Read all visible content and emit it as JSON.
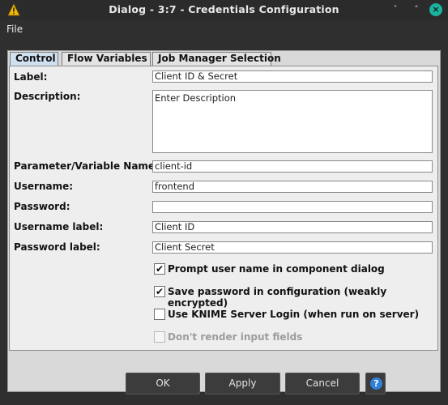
{
  "window": {
    "title": "Dialog - 3:7 - Credentials Configuration",
    "minimize_glyph": "ˇ",
    "maximize_glyph": "˄",
    "close_glyph": "×",
    "app_icon": "warning-triangle-icon"
  },
  "menu": {
    "file_label": "File"
  },
  "tabs": [
    {
      "label": "Control",
      "active": true
    },
    {
      "label": "Flow Variables",
      "active": false
    },
    {
      "label": "Job Manager Selection",
      "active": false
    }
  ],
  "form": {
    "label": {
      "label": "Label:",
      "value": "Client ID & Secret"
    },
    "description": {
      "label": "Description:",
      "value": "Enter Description"
    },
    "param_name": {
      "label": "Parameter/Variable Name:",
      "value": "client-id"
    },
    "username": {
      "label": "Username:",
      "value": "frontend"
    },
    "password": {
      "label": "Password:",
      "value": ""
    },
    "username_label": {
      "label": "Username label:",
      "value": "Client ID"
    },
    "password_label": {
      "label": "Password label:",
      "value": "Client Secret"
    }
  },
  "checkboxes": [
    {
      "label": "Prompt user name in component dialog",
      "checked": true,
      "enabled": true
    },
    {
      "label": "Save password in configuration (weakly encrypted)",
      "checked": true,
      "enabled": true
    },
    {
      "label": "Use KNIME Server Login (when run on server)",
      "checked": false,
      "enabled": true
    },
    {
      "label": "Don't render input fields",
      "checked": false,
      "enabled": false
    }
  ],
  "check_glyph": "✔",
  "buttons": {
    "ok": "OK",
    "apply": "Apply",
    "cancel": "Cancel",
    "help": "?"
  },
  "colors": {
    "close_accent": "#19b3a0",
    "help_accent": "#2f80d8",
    "warning_accent": "#f2b705"
  }
}
